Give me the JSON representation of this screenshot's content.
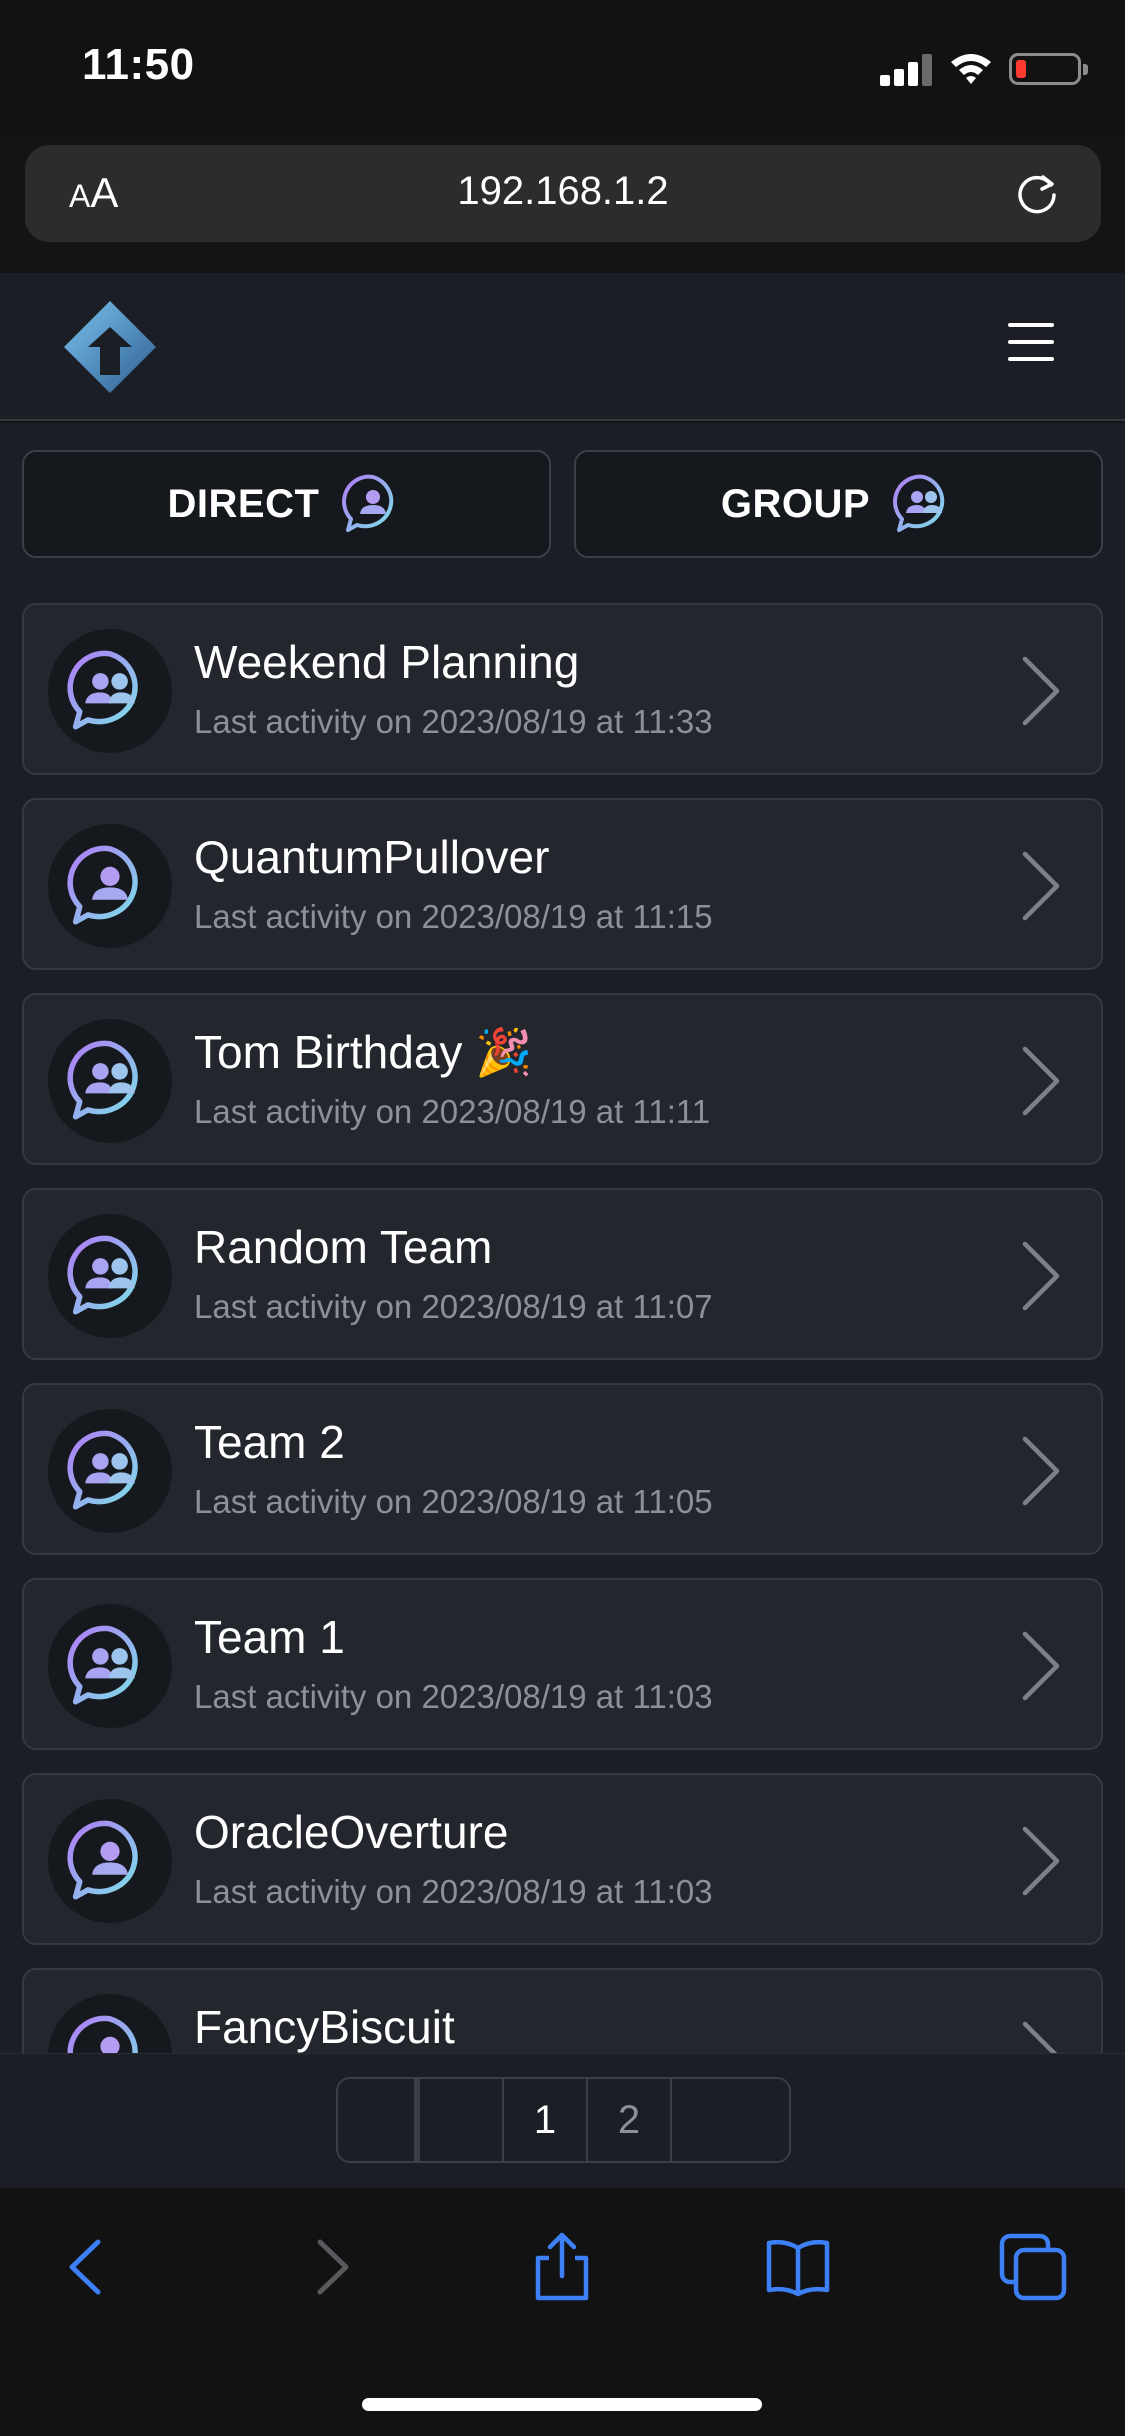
{
  "status_bar": {
    "time": "11:50"
  },
  "browser": {
    "text_size_label_small": "A",
    "text_size_label_large": "A",
    "url": "192.168.1.2"
  },
  "tabs": {
    "direct_label": "DIRECT",
    "group_label": "GROUP"
  },
  "conversations": [
    {
      "title": "Weekend Planning",
      "subtitle": "Last activity on 2023/08/19 at 11:33",
      "type": "group"
    },
    {
      "title": "QuantumPullover",
      "subtitle": "Last activity on 2023/08/19 at 11:15",
      "type": "direct"
    },
    {
      "title": "Tom Birthday 🎉",
      "subtitle": "Last activity on 2023/08/19 at 11:11",
      "type": "group"
    },
    {
      "title": "Random Team",
      "subtitle": "Last activity on 2023/08/19 at 11:07",
      "type": "group"
    },
    {
      "title": "Team 2",
      "subtitle": "Last activity on 2023/08/19 at 11:05",
      "type": "group"
    },
    {
      "title": "Team 1",
      "subtitle": "Last activity on 2023/08/19 at 11:03",
      "type": "group"
    },
    {
      "title": "OracleOverture",
      "subtitle": "Last activity on 2023/08/19 at 11:03",
      "type": "direct"
    },
    {
      "title": "FancyBiscuit",
      "subtitle": "",
      "type": "direct"
    }
  ],
  "pagination": {
    "pages": [
      "1",
      "2"
    ],
    "current": "1"
  },
  "colors": {
    "accent_blue": "#3d7ff5",
    "icon_gradient_start": "#b07cf6",
    "icon_gradient_end": "#7ce0e8",
    "background": "#1b1e24",
    "card": "#23262c"
  },
  "icons": {
    "direct": "person-chat-bubble-icon",
    "group": "people-chat-bubble-icon",
    "toolbar": [
      "back-icon",
      "forward-icon",
      "share-icon",
      "bookmarks-icon",
      "tabs-icon"
    ]
  }
}
